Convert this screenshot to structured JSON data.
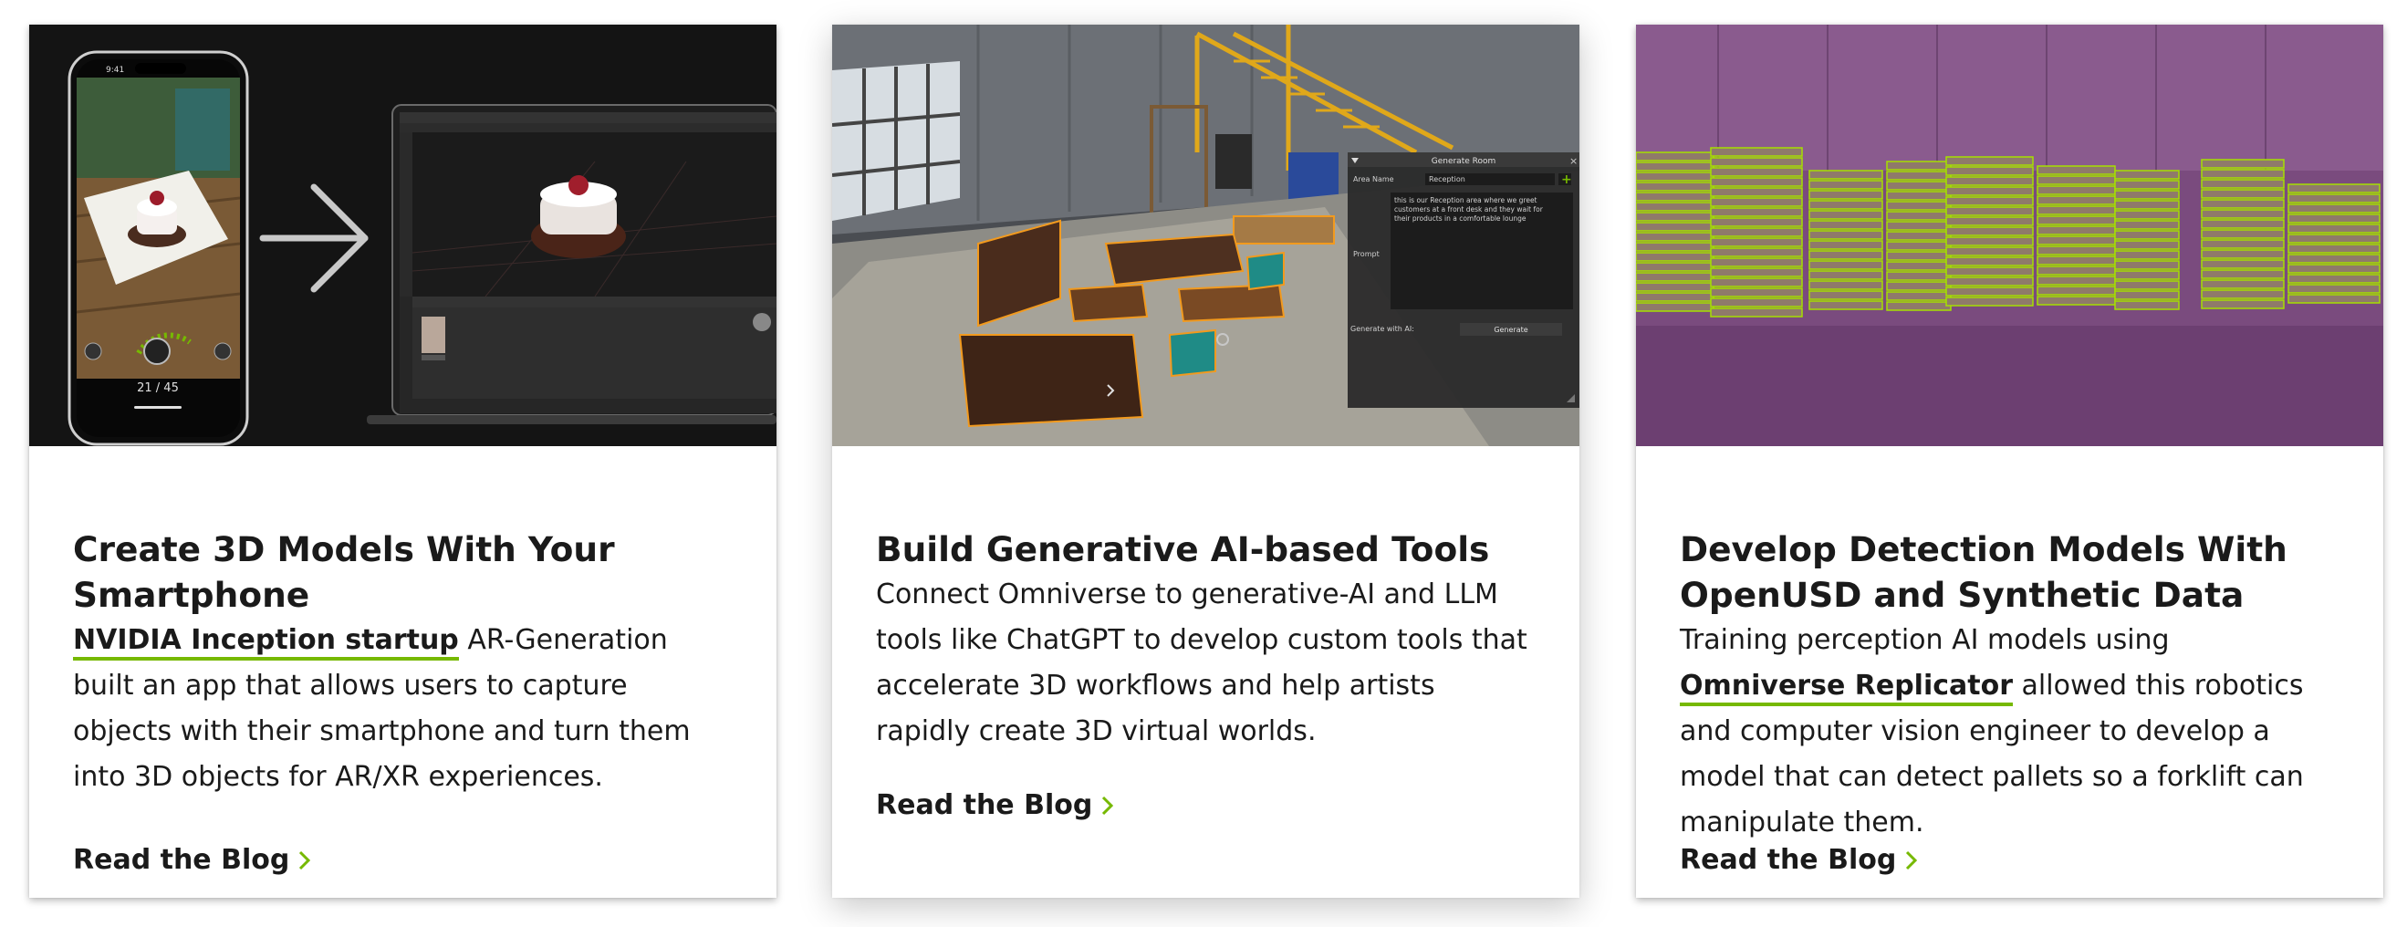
{
  "cards": [
    {
      "title": "Create 3D Models With Your Smartphone",
      "link_text": "NVIDIA Inception startup",
      "text": " AR-Generation built an app that allows users to capture objects with their smartphone and turn them into 3D objects for AR/XR experiences.",
      "cta": "Read the Blog",
      "media": {
        "phone_time": "9:41",
        "phone_counter": "21 / 45"
      }
    },
    {
      "title": "Build Generative AI-based Tools",
      "text": "Connect Omniverse to generative-AI and LLM tools like ChatGPT to develop custom tools that accelerate 3D workflows and help artists rapidly create 3D virtual worlds.",
      "cta": "Read the Blog",
      "media": {
        "panel_title": "Generate Room",
        "area_name_label": "Area Name",
        "area_name_value": "Reception",
        "prompt_label": "Prompt",
        "prompt_line1": "this is our Reception area where we greet",
        "prompt_line2": "customers at a front desk and they wait for",
        "prompt_line3": "their products in a comfortable lounge",
        "generate_with_label": "Generate with AI:",
        "generate_button": "Generate"
      }
    },
    {
      "title": "Develop Detection Models With OpenUSD and Synthetic Data",
      "text_before": "Training perception AI models using ",
      "link_text": "Omniverse Replicator",
      "text_after": " allowed this robotics and computer vision engineer to develop a model that can detect pallets so a forklift can manipulate them.",
      "cta": "Read the Blog"
    }
  ],
  "colors": {
    "accent": "#76b900",
    "text": "#1a1a1a",
    "card_bg": "#ffffff"
  },
  "icons": [
    "arrow-right-icon",
    "chevron-right-icon",
    "plus-icon",
    "close-icon"
  ]
}
